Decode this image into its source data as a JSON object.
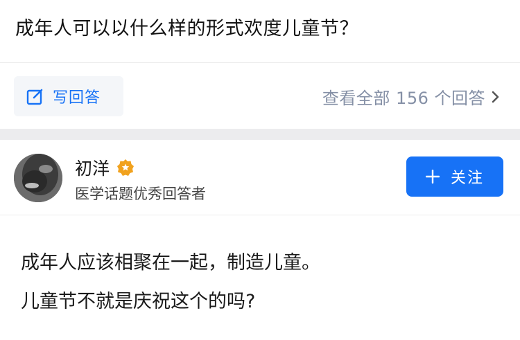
{
  "question": {
    "title": "成年人可以以什么样的形式欢度儿童节？"
  },
  "actions": {
    "write_answer_label": "写回答",
    "view_all_label": "查看全部 156 个回答"
  },
  "author": {
    "name": "初洋",
    "description": "医学话题优秀回答者",
    "follow_label": "关注"
  },
  "answer": {
    "lines": [
      "成年人应该相聚在一起，制造儿童。",
      "儿童节不就是庆祝这个的吗?"
    ]
  },
  "colors": {
    "accent": "#1772f6",
    "badge": "#f1a21e",
    "muted": "#8590a6"
  }
}
